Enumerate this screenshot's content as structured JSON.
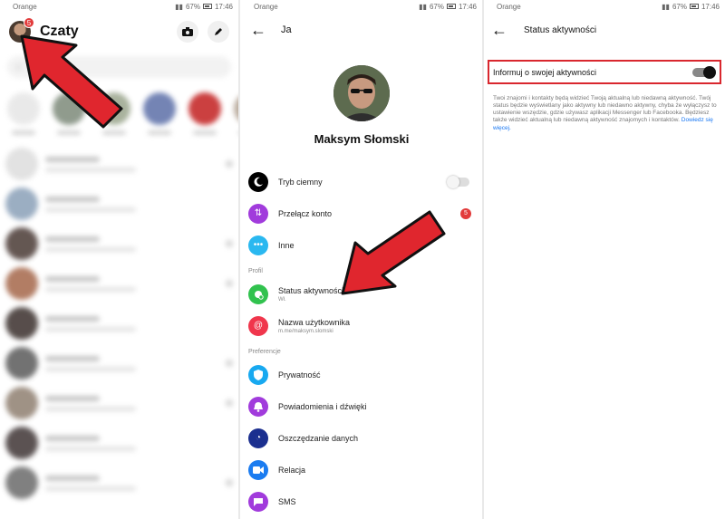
{
  "status_bar": {
    "carrier": "Orange",
    "battery": "67%",
    "time": "17:46"
  },
  "chats_screen": {
    "title": "Czaty",
    "avatar_badge": "5",
    "camera_icon": "camera-icon",
    "compose_icon": "pencil-icon"
  },
  "profile_screen": {
    "header_title": "Ja",
    "name": "Maksym Słomski",
    "items": [
      {
        "label": "Tryb ciemny",
        "icon": "moon-icon",
        "color": "#000000"
      },
      {
        "label": "Przełącz konto",
        "icon": "switch-account-icon",
        "color": "#a13bdc",
        "badge": "5"
      },
      {
        "label": "Inne",
        "icon": "more-icon",
        "color": "#2ab8f0"
      }
    ],
    "section_profile": "Profil",
    "profile_items": [
      {
        "label": "Status aktywności",
        "sub": "Wł.",
        "icon": "activity-status-icon",
        "color": "#31c24e"
      },
      {
        "label": "Nazwa użytkownika",
        "sub": "m.me/maksym.slomski",
        "icon": "at-icon",
        "color": "#f0364c"
      }
    ],
    "section_prefs": "Preferencje",
    "pref_items": [
      {
        "label": "Prywatność",
        "icon": "shield-icon",
        "color": "#18a9f0"
      },
      {
        "label": "Powiadomienia i dźwięki",
        "icon": "bell-icon",
        "color": "#a13bdc"
      },
      {
        "label": "Oszczędzanie danych",
        "icon": "data-saver-icon",
        "color": "#1b2f8f"
      },
      {
        "label": "Relacja",
        "icon": "story-icon",
        "color": "#1b7cf0"
      },
      {
        "label": "SMS",
        "icon": "sms-icon",
        "color": "#a13bdc"
      }
    ]
  },
  "activity_screen": {
    "title": "Status aktywności",
    "toggle_label": "Informuj o swojej aktywności",
    "description": "Twoi znajomi i kontakty będą widzieć Twoją aktualną lub niedawną aktywność. Twój status będzie wyświetlany jako aktywny lub niedawno aktywny, chyba że wyłączysz to ustawienie wszędzie, gdzie używasz aplikacji Messenger lub Facebooka. Będziesz także widzieć aktualną lub niedawną aktywność znajomych i kontaktów.",
    "link_text": "Dowiedz się więcej."
  },
  "colors": {
    "annotation_red": "#d9272e",
    "badge_red": "#e23b3b",
    "link_blue": "#1877f2"
  }
}
